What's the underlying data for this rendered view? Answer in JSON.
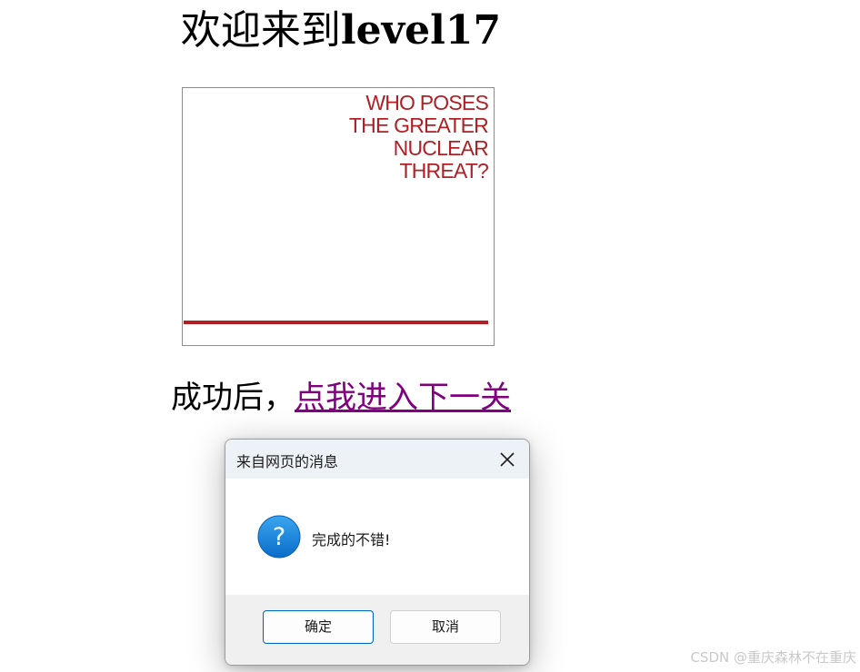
{
  "page": {
    "title_prefix": "欢迎来到",
    "title_level": "level17",
    "success_text": "成功后，",
    "next_link": "点我进入下一关"
  },
  "poster": {
    "headline": "WHO POSES\nTHE GREATER\nNUCLEAR\nTHREAT?",
    "accent_color": "#b11f24"
  },
  "dialog": {
    "title": "来自网页的消息",
    "close_icon": "close-icon",
    "icon": "question-icon",
    "message": "完成的不错!",
    "ok_label": "确定",
    "cancel_label": "取消",
    "primary_color": "#0067c0"
  },
  "watermark": "CSDN @重庆森林不在重庆"
}
